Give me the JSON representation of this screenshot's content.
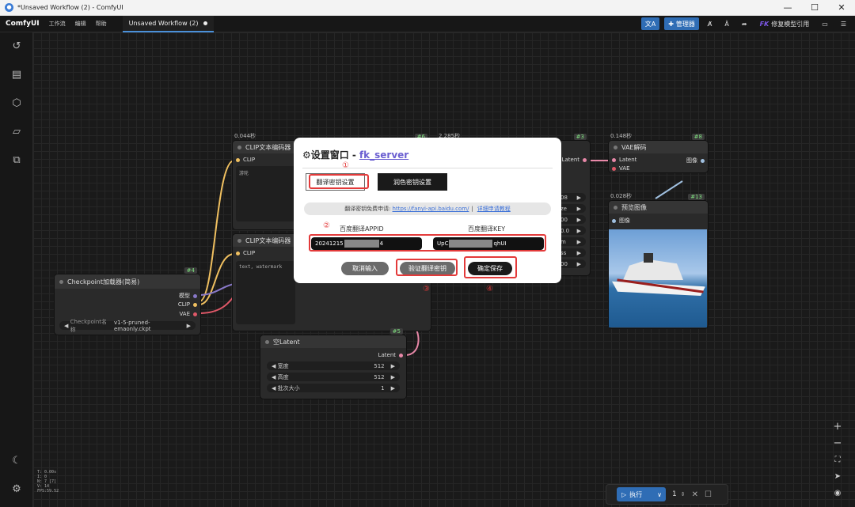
{
  "window": {
    "title": "*Unsaved Workflow (2) - ComfyUI",
    "min": "—",
    "max": "☐",
    "close": "✕"
  },
  "menubar": {
    "brand": "ComfyUI",
    "menus": [
      "工作流",
      "编辑",
      "帮助"
    ],
    "tab": "Unsaved Workflow (2)",
    "manager": "管理器",
    "fix_models": "修复模型引用",
    "fk": "FK"
  },
  "nodes": {
    "clip_top": {
      "time": "0.044秒",
      "id": "#6",
      "title": "CLIP文本编码器",
      "port": "CLIP",
      "text": "游轮"
    },
    "clip_bottom": {
      "title": "CLIP文本编码器",
      "port": "CLIP",
      "text": "text, watermark"
    },
    "checkpoint": {
      "id": "#4",
      "title": "Checkpoint加载器(简易)",
      "out1": "模型",
      "out2": "CLIP",
      "out3": "VAE",
      "widget_label": "Checkpoint名称",
      "widget_value": "v1-5-pruned-emaonly.ckpt"
    },
    "ksampler": {
      "time": "2.285秒",
      "id": "#3",
      "out": "Latent",
      "rows": [
        "08",
        "ze",
        "00",
        "0.0",
        "m",
        "ss",
        "00"
      ]
    },
    "vae": {
      "time": "0.148秒",
      "id": "#8",
      "title": "VAE解码",
      "in1": "Latent",
      "in2": "VAE",
      "out": "图像"
    },
    "preview": {
      "time": "0.028秒",
      "id": "#13",
      "title": "预览图像",
      "in": "图像"
    },
    "latent": {
      "id": "#5",
      "title": "空Latent",
      "out": "Latent",
      "w_label": "宽度",
      "w_value": "512",
      "h_label": "高度",
      "h_value": "512",
      "b_label": "批次大小",
      "b_value": "1"
    }
  },
  "modal": {
    "title_prefix": "⚙设置窗口 - ",
    "title_link": "fk_server",
    "tab_translate": "翻译密钥设置",
    "tab_polish": "润色密钥设置",
    "info_text": "翻译密钥免费申请:",
    "info_url": "https://fanyi-api.baidu.com/",
    "info_sep": "|",
    "info_tutorial": "详细申请教程",
    "appid_label": "百度翻译APPID",
    "appid_prefix": "20241215",
    "appid_suffix": "4",
    "key_label": "百度翻译KEY",
    "key_prefix": "UpC",
    "key_suffix": "qhUI",
    "cancel": "取消输入",
    "verify": "验证翻译密钥",
    "save": "确定保存",
    "marks": [
      "①",
      "②",
      "③",
      "④"
    ]
  },
  "stats": [
    "T: 0.00s",
    "I: 0",
    "N: 7 [7]",
    "V: 14",
    "FPS:59.52"
  ],
  "runbar": {
    "run_label": "执行",
    "count": "1"
  }
}
